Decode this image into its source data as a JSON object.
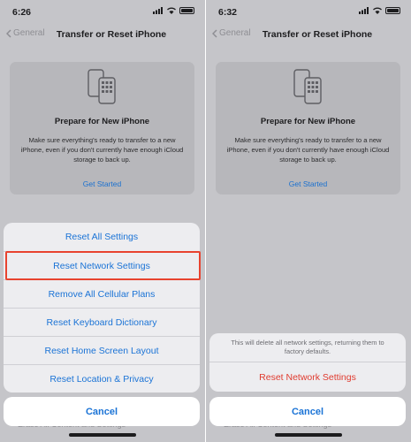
{
  "left": {
    "status_time": "6:26",
    "nav": {
      "back_label": "General",
      "title": "Transfer or Reset iPhone"
    },
    "card": {
      "title": "Prepare for New iPhone",
      "body": "Make sure everything's ready to transfer to a new iPhone, even if you don't currently have enough iCloud storage to back up.",
      "link": "Get Started"
    },
    "sheet_items": [
      "Reset All Settings",
      "Reset Network Settings",
      "Remove All Cellular Plans",
      "Reset Keyboard Dictionary",
      "Reset Home Screen Layout",
      "Reset Location & Privacy"
    ],
    "highlighted_item": "Reset Network Settings",
    "cancel_label": "Cancel"
  },
  "right": {
    "status_time": "6:32",
    "nav": {
      "back_label": "General",
      "title": "Transfer or Reset iPhone"
    },
    "card": {
      "title": "Prepare for New iPhone",
      "body": "Make sure everything's ready to transfer to a new iPhone, even if you don't currently have enough iCloud storage to back up.",
      "link": "Get Started"
    },
    "confirm_message": "This will delete all network settings, returning them to factory defaults.",
    "confirm_action": "Reset Network Settings",
    "cancel_label": "Cancel"
  },
  "colors": {
    "accent": "#1a73d6",
    "destructive": "#e03b2f",
    "highlight_border": "#e8432f"
  }
}
